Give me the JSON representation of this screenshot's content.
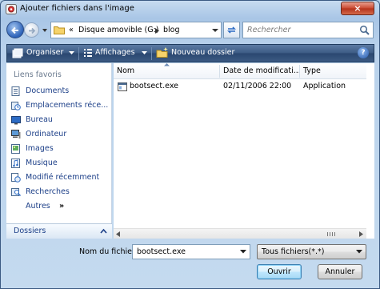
{
  "window": {
    "title": "Ajouter fichiers dans l'image",
    "close_glyph": "×"
  },
  "nav": {
    "breadcrumb_prefix": "«",
    "breadcrumb": [
      "Disque amovible (G:)",
      "blog"
    ],
    "search_placeholder": "Rechercher"
  },
  "toolbar": {
    "organize": "Organiser",
    "views": "Affichages",
    "new_folder": "Nouveau dossier",
    "help": "?"
  },
  "sidebar": {
    "header": "Liens favoris",
    "items": [
      {
        "label": "Documents",
        "icon": "documents-icon"
      },
      {
        "label": "Emplacements réce...",
        "icon": "recent-places-icon"
      },
      {
        "label": "Bureau",
        "icon": "desktop-icon"
      },
      {
        "label": "Ordinateur",
        "icon": "computer-icon"
      },
      {
        "label": "Images",
        "icon": "pictures-icon"
      },
      {
        "label": "Musique",
        "icon": "music-icon"
      },
      {
        "label": "Modifié récemment",
        "icon": "recently-changed-icon"
      },
      {
        "label": "Recherches",
        "icon": "searches-icon"
      }
    ],
    "more": "Autres",
    "more_glyph": "»",
    "folders": "Dossiers"
  },
  "filelist": {
    "columns": [
      "Nom",
      "Date de modificati...",
      "Type"
    ],
    "rows": [
      {
        "name": "bootsect.exe",
        "date": "02/11/2006 22:00",
        "type": "Application"
      }
    ]
  },
  "footer": {
    "filename_label": "Nom du fichier :",
    "filename_value": "bootsect.exe",
    "filter_value": "Tous fichiers(*.*)",
    "open_label": "Ouvrir",
    "cancel_label": "Annuler"
  },
  "colors": {
    "link": "#1c3f88",
    "toolbar": "#3d5c85",
    "close": "#c9472f"
  }
}
